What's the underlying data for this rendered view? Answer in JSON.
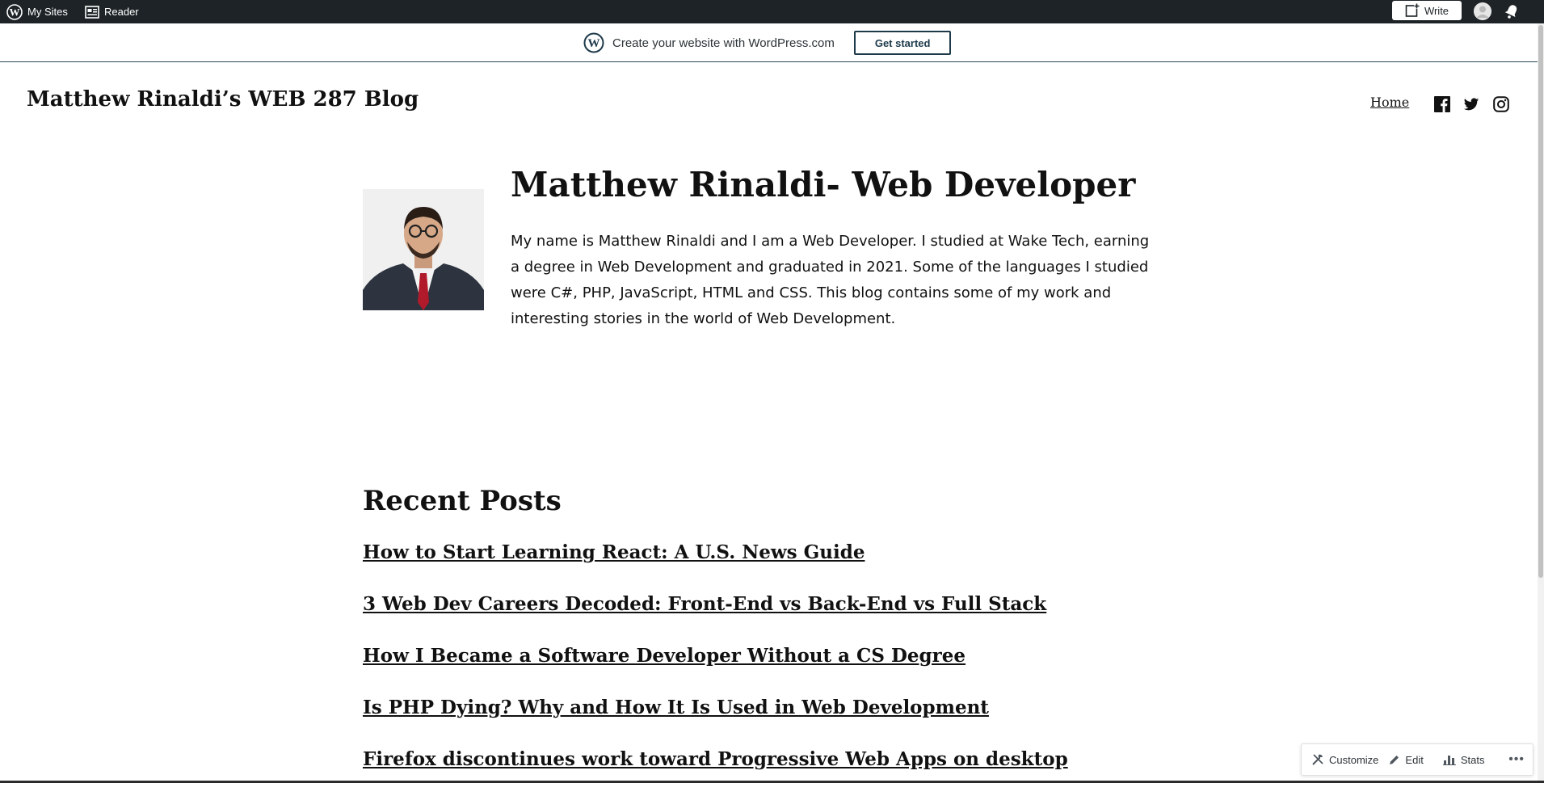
{
  "admin_bar": {
    "my_sites": "My Sites",
    "reader": "Reader",
    "write": "Write"
  },
  "banner": {
    "text": "Create your website with WordPress.com",
    "cta": "Get started"
  },
  "header": {
    "site_title": "Matthew Rinaldi’s WEB 287 Blog",
    "nav_home": "Home",
    "social": [
      "facebook-icon",
      "twitter-icon",
      "instagram-icon"
    ]
  },
  "hero": {
    "title": "Matthew Rinaldi- Web Developer",
    "bio_lines": [
      "My name is Matthew Rinaldi and I am a Web Developer. I studied at Wake Tech, earning",
      "a degree in Web Development and graduated in 2021. Some of the languages I studied",
      "were C#, PHP, JavaScript, HTML and CSS. This blog contains some of my work and",
      "interesting stories in the world of Web Development."
    ]
  },
  "recent_posts": {
    "heading": "Recent Posts",
    "items": [
      "How to Start Learning React: A U.S. News Guide",
      "3 Web Dev Careers Decoded: Front-End vs Back-End vs Full Stack",
      "How I Became a Software Developer Without a CS Degree",
      "Is PHP Dying? Why and How It Is Used in Web Development",
      "Firefox discontinues work toward Progressive Web Apps on desktop"
    ]
  },
  "action_bar": {
    "customize": "Customize",
    "edit": "Edit",
    "stats": "Stats"
  },
  "colors": {
    "admin_bar_bg": "#1d2327",
    "banner_button_border": "#1e3a4a",
    "text": "#111111"
  }
}
